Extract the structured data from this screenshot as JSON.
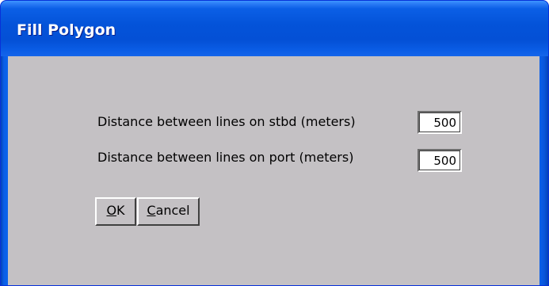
{
  "window": {
    "title": "Fill Polygon"
  },
  "form": {
    "stbd_label": "Distance between lines on stbd (meters)",
    "stbd_value": "500",
    "port_label": "Distance between lines on port (meters)",
    "port_value": "500"
  },
  "buttons": {
    "ok_label_mnemonic": "O",
    "ok_label_rest": "K",
    "cancel_label_mnemonic": "C",
    "cancel_label_rest": "ancel"
  },
  "colors": {
    "titlebar": "#0453d9",
    "client_background": "#c4c1c4",
    "title_text": "#ffffff"
  }
}
